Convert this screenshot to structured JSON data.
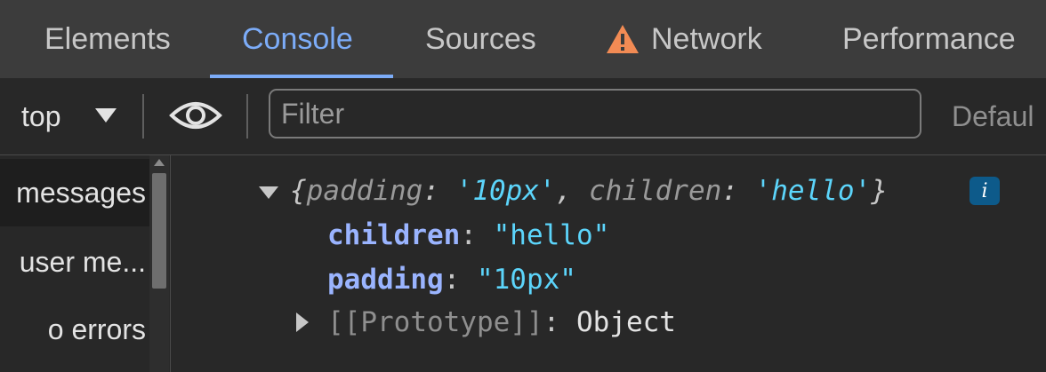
{
  "tabs": [
    {
      "label": "Elements"
    },
    {
      "label": "Console"
    },
    {
      "label": "Sources"
    },
    {
      "label": "Network"
    },
    {
      "label": "Performance"
    }
  ],
  "colors": {
    "accent": "#7cacf8",
    "warning": "#f28b54",
    "string": "#5cd5fb",
    "property": "#9ab4ff"
  },
  "toolbar": {
    "context": "top",
    "filter_placeholder": "Filter",
    "filter_value": "",
    "levels": "Defaul"
  },
  "icons": {
    "warning": "warning-triangle-icon",
    "context_caret": "chevron-down-icon",
    "live_expression": "eye-icon",
    "info": "info-icon"
  },
  "sidebar": {
    "items": [
      {
        "label": "messages"
      },
      {
        "label": "user me..."
      },
      {
        "label": "o errors"
      }
    ]
  },
  "console": {
    "preview": {
      "open": "{",
      "key1": "padding",
      "sep1": ": ",
      "val1": "'10px'",
      "comma": ", ",
      "key2": "children",
      "sep2": ": ",
      "val2": "'hello'",
      "close": "}"
    },
    "info_label": "i",
    "properties": [
      {
        "key": "children",
        "value": "\"hello\""
      },
      {
        "key": "padding",
        "value": "\"10px\""
      }
    ],
    "prototype": {
      "key": "[[Prototype]]",
      "value": "Object"
    }
  }
}
